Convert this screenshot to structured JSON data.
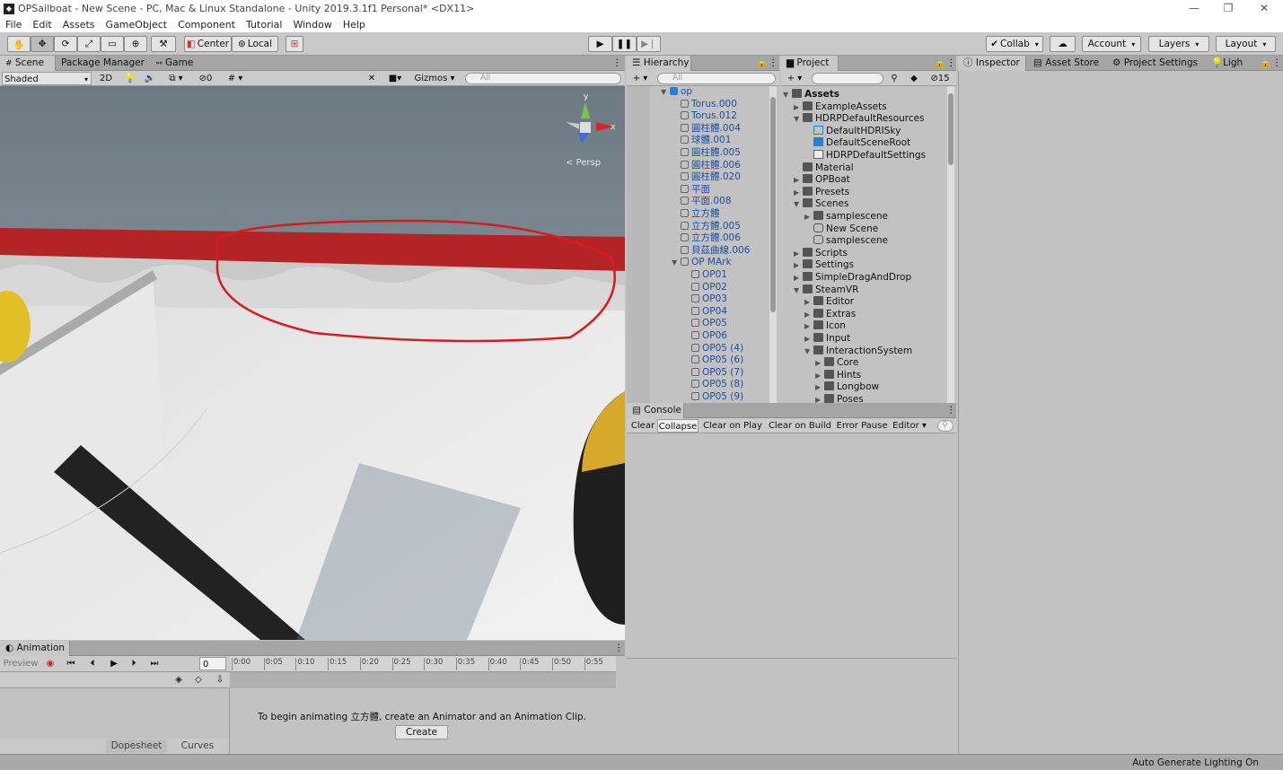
{
  "window": {
    "title": "OPSailboat - New Scene - PC, Mac & Linux Standalone - Unity 2019.3.1f1 Personal* <DX11>"
  },
  "menu": [
    "File",
    "Edit",
    "Assets",
    "GameObject",
    "Component",
    "Tutorial",
    "Window",
    "Help"
  ],
  "toolbar": {
    "center": "Center",
    "local": "Local",
    "collab": "Collab",
    "account": "Account",
    "layers": "Layers",
    "layout": "Layout"
  },
  "scene_tabs": {
    "scene": "Scene",
    "package": "Package Manager",
    "game": "Game"
  },
  "scene_bar": {
    "shaded": "Shaded",
    "mode2d": "2D",
    "hidden": "0",
    "gizmos": "Gizmos",
    "search": "All",
    "persp": "< Persp"
  },
  "hierarchy": {
    "tab": "Hierarchy",
    "search": "All",
    "items": [
      {
        "label": "op",
        "indent": 0,
        "arrow": "▼",
        "cls": "blue"
      },
      {
        "label": "Torus.000",
        "indent": 1,
        "arrow": "",
        "cls": "blue"
      },
      {
        "label": "Torus.012",
        "indent": 1,
        "arrow": "",
        "cls": "blue"
      },
      {
        "label": "圓柱體.004",
        "indent": 1,
        "arrow": "",
        "cls": "blue"
      },
      {
        "label": "球體.001",
        "indent": 1,
        "arrow": "",
        "cls": "blue"
      },
      {
        "label": "圓柱體.005",
        "indent": 1,
        "arrow": "",
        "cls": "blue"
      },
      {
        "label": "圓柱體.006",
        "indent": 1,
        "arrow": "",
        "cls": "blue"
      },
      {
        "label": "圓柱體.020",
        "indent": 1,
        "arrow": "",
        "cls": "blue"
      },
      {
        "label": "平面",
        "indent": 1,
        "arrow": "",
        "cls": "blue"
      },
      {
        "label": "平面.008",
        "indent": 1,
        "arrow": "",
        "cls": "blue"
      },
      {
        "label": "立方體",
        "indent": 1,
        "arrow": "",
        "cls": "blue"
      },
      {
        "label": "立方體.005",
        "indent": 1,
        "arrow": "",
        "cls": "blue"
      },
      {
        "label": "立方體.006",
        "indent": 1,
        "arrow": "",
        "cls": "blue"
      },
      {
        "label": "貝茲曲線.006",
        "indent": 1,
        "arrow": "",
        "cls": "blue"
      },
      {
        "label": "OP MArk",
        "indent": 1,
        "arrow": "▼",
        "cls": "blue"
      },
      {
        "label": "OP01",
        "indent": 2,
        "arrow": "",
        "cls": "blue"
      },
      {
        "label": "OP02",
        "indent": 2,
        "arrow": "",
        "cls": "blue"
      },
      {
        "label": "OP03",
        "indent": 2,
        "arrow": "",
        "cls": "blue"
      },
      {
        "label": "OP04",
        "indent": 2,
        "arrow": "",
        "cls": "blue"
      },
      {
        "label": "OP05",
        "indent": 2,
        "arrow": "",
        "cls": "blue"
      },
      {
        "label": "OP06",
        "indent": 2,
        "arrow": "",
        "cls": "blue"
      },
      {
        "label": "OP05 (4)",
        "indent": 2,
        "arrow": "",
        "cls": "blue"
      },
      {
        "label": "OP05 (6)",
        "indent": 2,
        "arrow": "",
        "cls": "blue"
      },
      {
        "label": "OP05 (7)",
        "indent": 2,
        "arrow": "",
        "cls": "blue"
      },
      {
        "label": "OP05 (8)",
        "indent": 2,
        "arrow": "",
        "cls": "blue"
      },
      {
        "label": "OP05 (9)",
        "indent": 2,
        "arrow": "",
        "cls": "blue"
      }
    ]
  },
  "project": {
    "tab": "Project",
    "hidden": "15",
    "items": [
      {
        "label": "Assets",
        "indent": 0,
        "arrow": "▼",
        "bold": true
      },
      {
        "label": "ExampleAssets",
        "indent": 1,
        "arrow": "▶"
      },
      {
        "label": "HDRPDefaultResources",
        "indent": 1,
        "arrow": "▼"
      },
      {
        "label": "DefaultHDRISky",
        "indent": 2,
        "arrow": ""
      },
      {
        "label": "DefaultSceneRoot",
        "indent": 2,
        "arrow": ""
      },
      {
        "label": "HDRPDefaultSettings",
        "indent": 2,
        "arrow": ""
      },
      {
        "label": "Material",
        "indent": 1,
        "arrow": ""
      },
      {
        "label": "OPBoat",
        "indent": 1,
        "arrow": "▶"
      },
      {
        "label": "Presets",
        "indent": 1,
        "arrow": "▶"
      },
      {
        "label": "Scenes",
        "indent": 1,
        "arrow": "▼"
      },
      {
        "label": "samplescene",
        "indent": 2,
        "arrow": "▶"
      },
      {
        "label": "New Scene",
        "indent": 2,
        "arrow": ""
      },
      {
        "label": "samplescene",
        "indent": 2,
        "arrow": ""
      },
      {
        "label": "Scripts",
        "indent": 1,
        "arrow": "▶"
      },
      {
        "label": "Settings",
        "indent": 1,
        "arrow": "▶"
      },
      {
        "label": "SimpleDragAndDrop",
        "indent": 1,
        "arrow": "▶"
      },
      {
        "label": "SteamVR",
        "indent": 1,
        "arrow": "▼"
      },
      {
        "label": "Editor",
        "indent": 2,
        "arrow": "▶"
      },
      {
        "label": "Extras",
        "indent": 2,
        "arrow": "▶"
      },
      {
        "label": "Icon",
        "indent": 2,
        "arrow": "▶"
      },
      {
        "label": "Input",
        "indent": 2,
        "arrow": "▶"
      },
      {
        "label": "InteractionSystem",
        "indent": 2,
        "arrow": "▼"
      },
      {
        "label": "Core",
        "indent": 3,
        "arrow": "▶"
      },
      {
        "label": "Hints",
        "indent": 3,
        "arrow": "▶"
      },
      {
        "label": "Longbow",
        "indent": 3,
        "arrow": "▶"
      },
      {
        "label": "Poses",
        "indent": 3,
        "arrow": "▶"
      }
    ]
  },
  "inspector_tabs": {
    "inspector": "Inspector",
    "asset_store": "Asset Store",
    "project_settings": "Project Settings",
    "lighting": "Ligh"
  },
  "console": {
    "tab": "Console",
    "clear": "Clear",
    "collapse": "Collapse",
    "clear_on_play": "Clear on Play",
    "clear_on_build": "Clear on Build",
    "error_pause": "Error Pause",
    "editor": "Editor"
  },
  "animation": {
    "tab": "Animation",
    "preview": "Preview",
    "frame": "0",
    "times": [
      "0:00",
      "0:05",
      "0:10",
      "0:15",
      "0:20",
      "0:25",
      "0:30",
      "0:35",
      "0:40",
      "0:45",
      "0:50",
      "0:55"
    ],
    "message": "To begin animating 立方體, create an Animator and an Animation Clip.",
    "create": "Create",
    "dopesheet": "Dopesheet",
    "curves": "Curves"
  },
  "status": {
    "text": "Auto Generate Lighting On"
  }
}
